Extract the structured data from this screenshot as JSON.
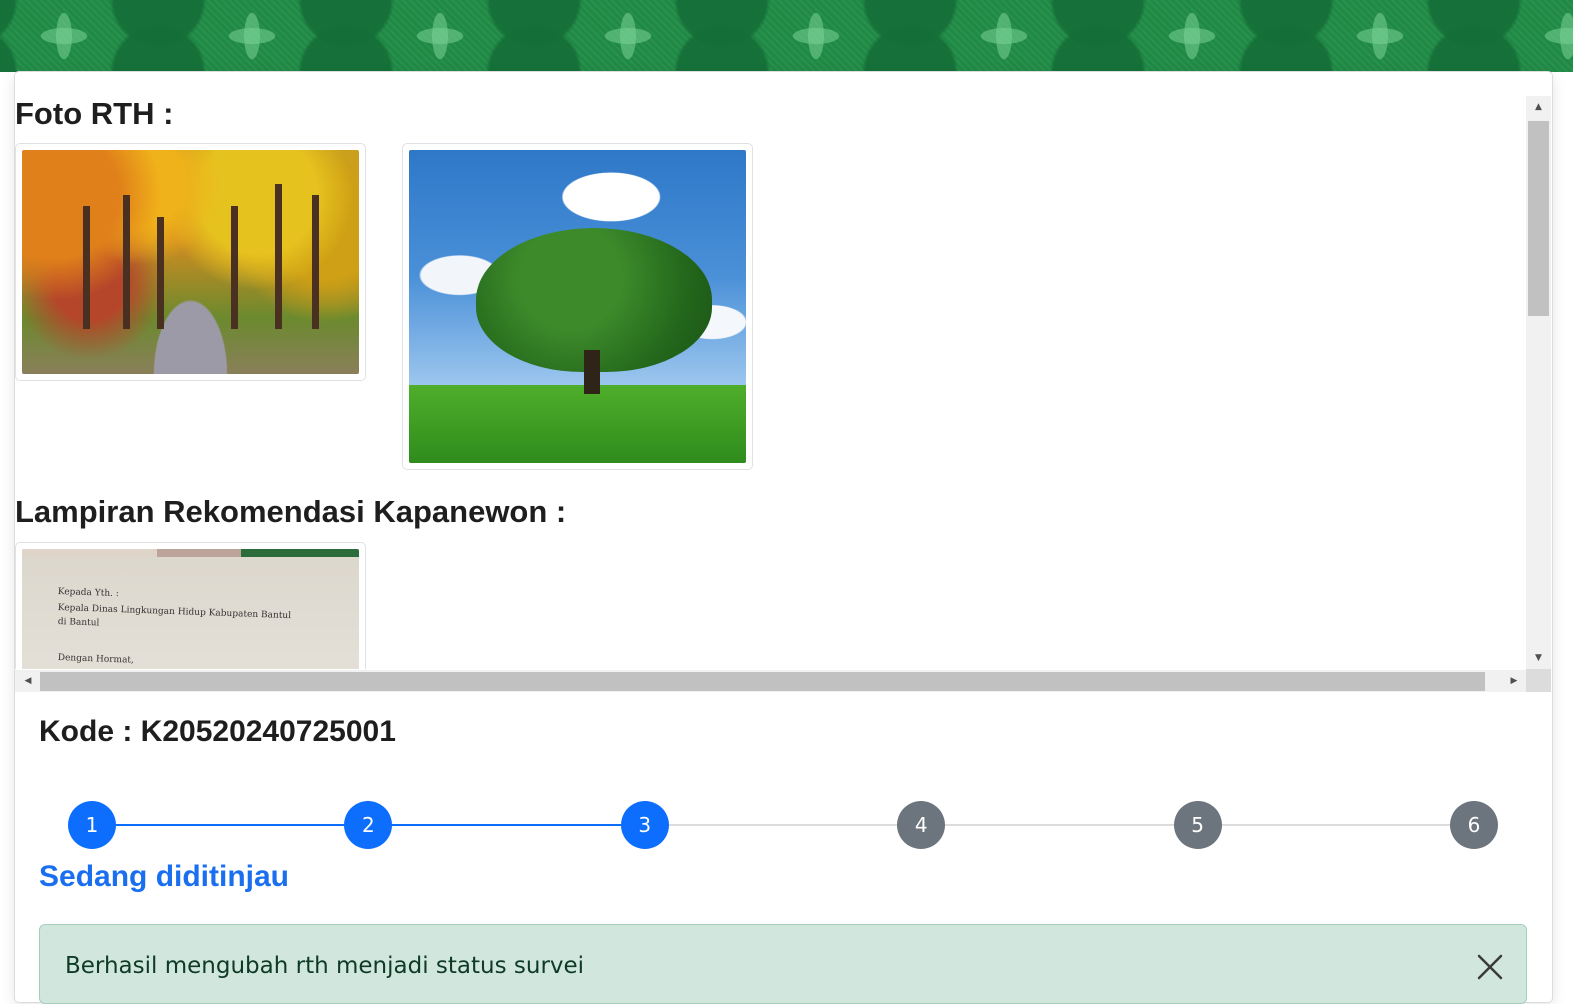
{
  "sections": {
    "foto_rth_title": "Foto RTH :",
    "lampiran_title": "Lampiran Rekomendasi Kapanewon :"
  },
  "photos": [
    {
      "name": "autumn-road-photo"
    },
    {
      "name": "single-tree-photo"
    }
  ],
  "lampiran_letter": {
    "lines": [
      "Kepada Yth. :",
      "Kepala Dinas Lingkungan Hidup Kabupaten Bantul",
      "di Bantul",
      "Dengan Hormat,"
    ]
  },
  "kode": "Kode : K20520240725001",
  "stepper": {
    "steps": [
      "1",
      "2",
      "3",
      "4",
      "5",
      "6"
    ],
    "current_step": 3,
    "active_color": "#0d6efd",
    "inactive_color": "#6c757d"
  },
  "status_label": "Sedang diditinjau",
  "status_color": "#1a6ff0",
  "alert": {
    "message": "Berhasil mengubah rth menjadi status survei",
    "close_icon": "close-icon"
  },
  "banner_color": "#1f8a45"
}
